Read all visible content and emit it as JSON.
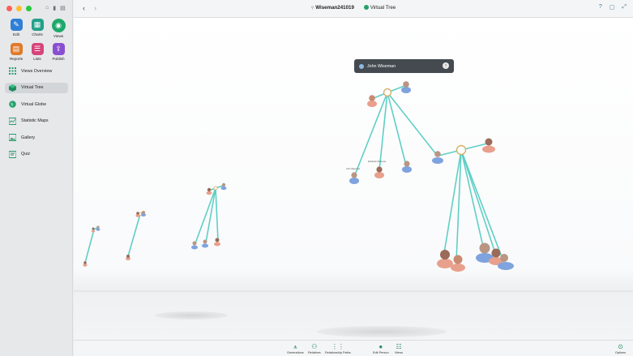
{
  "window": {
    "file_name": "Wiseman241019",
    "view_name": "Virtual Tree"
  },
  "sidebar": {
    "tools": [
      {
        "label": "Edit",
        "icon": "pencil-icon",
        "color": "#2f7fd6"
      },
      {
        "label": "Charts",
        "icon": "charts-icon",
        "color": "#23a08a"
      },
      {
        "label": "Views",
        "icon": "eye-icon",
        "color": "#1fa86b"
      },
      {
        "label": "Reports",
        "icon": "reports-icon",
        "color": "#e07a2a"
      },
      {
        "label": "Lists",
        "icon": "lists-icon",
        "color": "#d6457a"
      },
      {
        "label": "Publish",
        "icon": "publish-icon",
        "color": "#8a4fd0"
      }
    ],
    "nav": [
      {
        "label": "Views Overview",
        "icon": "grid-icon"
      },
      {
        "label": "Virtual Tree",
        "icon": "cube-icon",
        "active": true
      },
      {
        "label": "Virtual Globe",
        "icon": "globe-icon"
      },
      {
        "label": "Statistic Maps",
        "icon": "map-icon"
      },
      {
        "label": "Gallery",
        "icon": "gallery-icon"
      },
      {
        "label": "Quiz",
        "icon": "quiz-icon"
      }
    ]
  },
  "canvas": {
    "tooltip": {
      "name": "John Wiseman"
    },
    "labels": [
      "John Wiseman",
      "Elizabeth Wiseman"
    ]
  },
  "bottombar": {
    "items": [
      "Generations",
      "Relatives",
      "Relationship Paths",
      "Edit Person",
      "Views",
      "Options"
    ]
  },
  "colors": {
    "accent": "#25a06b",
    "connector": "#5fcfc6",
    "female": "#e8a08c",
    "male": "#7ea3de"
  }
}
